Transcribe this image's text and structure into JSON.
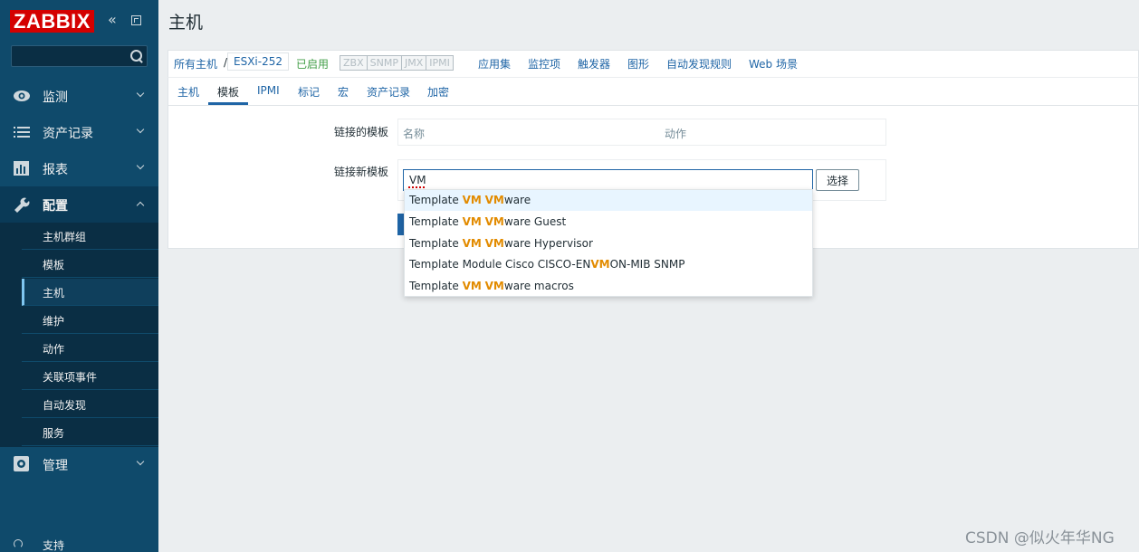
{
  "app": {
    "logo": "ZABBIX"
  },
  "sidebar": {
    "search_placeholder": "",
    "menu": [
      {
        "label": "监测",
        "icon": "eye-icon",
        "expanded": false
      },
      {
        "label": "资产记录",
        "icon": "list-icon",
        "expanded": false
      },
      {
        "label": "报表",
        "icon": "bar-chart-icon",
        "expanded": false
      },
      {
        "label": "配置",
        "icon": "wrench-icon",
        "expanded": true
      },
      {
        "label": "管理",
        "icon": "gear-icon",
        "expanded": false
      }
    ],
    "config_submenu": [
      "主机群组",
      "模板",
      "主机",
      "维护",
      "动作",
      "关联项事件",
      "自动发现",
      "服务"
    ],
    "active_submenu": "主机",
    "support_label": "支持"
  },
  "header": {
    "title": "主机"
  },
  "host_nav": {
    "all_hosts": "所有主机",
    "separator": "/",
    "current_host": "ESXi-252",
    "status": "已启用",
    "availability": [
      "ZBX",
      "SNMP",
      "JMX",
      "IPMI"
    ],
    "links": [
      "应用集",
      "监控项",
      "触发器",
      "图形",
      "自动发现规则",
      "Web 场景"
    ]
  },
  "tabs": {
    "items": [
      "主机",
      "模板",
      "IPMI",
      "标记",
      "宏",
      "资产记录",
      "加密"
    ],
    "active": "模板"
  },
  "form": {
    "linked_templates_label": "链接的模板",
    "linked_col_name": "名称",
    "linked_col_action": "动作",
    "link_new_label": "链接新模板",
    "input_value": "VM",
    "select_button": "选择"
  },
  "autocomplete": [
    {
      "pre": "Template ",
      "m1": "VM",
      "mid": " ",
      "m2": "VM",
      "post": "ware"
    },
    {
      "pre": "Template ",
      "m1": "VM",
      "mid": " ",
      "m2": "VM",
      "post": "ware Guest"
    },
    {
      "pre": "Template ",
      "m1": "VM",
      "mid": " ",
      "m2": "VM",
      "post": "ware Hypervisor"
    },
    {
      "pre": "Template Module Cisco CISCO-EN",
      "m1": "VM",
      "mid": "ON-MIB SNMP",
      "m2": "",
      "post": ""
    },
    {
      "pre": "Template ",
      "m1": "VM",
      "mid": " ",
      "m2": "VM",
      "post": "ware macros"
    }
  ],
  "watermark": "CSDN @似火年华NG",
  "colors": {
    "sidebar": "#0f4a6b",
    "logo": "#d40000",
    "link": "#1f65a6",
    "match_highlight": "#e28b00",
    "enabled": "#429e47"
  }
}
